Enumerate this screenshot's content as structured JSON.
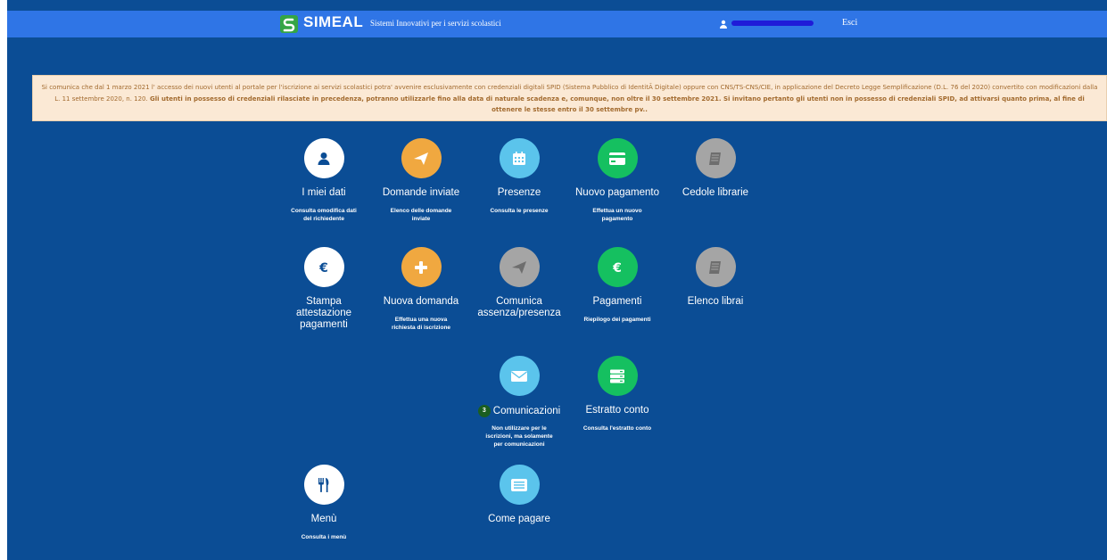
{
  "header": {
    "logo_text": "SIMEAL",
    "tagline": "Sistemi Innovativi per i servizi scolastici",
    "user_name": "",
    "logout_label": "Esci"
  },
  "notice": {
    "part1": "Si comunica che dal 1 marzo 2021 l' accesso dei nuovi utenti al portale per l'iscrizione ai servizi scolastici potra' avvenire esclusivamente con credenziali digitali SPID (Sistema Pubblico di IdentitÃ Digitale) oppure con CNS/TS-CNS/CIE, in applicazione del Decreto Legge Semplificazione (D.L. 76 del 2020) convertito con modificazioni dalla L. 11 settembre 2020, n. 120.",
    "part2": "Gli utenti in possesso di credenziali rilasciate in precedenza, potranno utilizzarle fino alla data di naturale scadenza e, comunque, non oltre il 30 settembre 2021. Si invitano pertanto gli utenti non in possesso di credenziali SPID, ad attivarsi quanto prima, al fine di ottenere le stesse entro il 30 settembre pv.."
  },
  "colors": {
    "background": "#0b4d95",
    "topbar": "#2f75e6",
    "white_circle": "#ffffff",
    "orange": "#f0a840",
    "light_blue": "#5bc4ec",
    "green": "#15c060",
    "gray": "#a5a5a5"
  },
  "tiles": {
    "miei_dati": {
      "title": "I miei dati",
      "desc": "Consulta omodifica dati del richiedente",
      "icon": "user-icon"
    },
    "domande_inviate": {
      "title": "Domande inviate",
      "desc": "Elenco delle domande inviate",
      "icon": "paper-plane-icon"
    },
    "presenze": {
      "title": "Presenze",
      "desc": "Consulta le presenze",
      "icon": "calendar-icon"
    },
    "nuovo_pagamento": {
      "title": "Nuovo pagamento",
      "desc": "Effettua un nuovo pagamento",
      "icon": "credit-card-icon"
    },
    "cedole_librarie": {
      "title": "Cedole librarie",
      "icon": "book-icon"
    },
    "stampa_attestazione": {
      "title": "Stampa attestazione pagamenti",
      "icon": "euro-icon"
    },
    "nuova_domanda": {
      "title": "Nuova domanda",
      "desc": "Effettua una nuova richiesta di iscrizione",
      "icon": "plus-icon"
    },
    "comunica_assenza": {
      "title": "Comunica assenza/presenza",
      "icon": "paper-plane-icon"
    },
    "pagamenti": {
      "title": "Pagamenti",
      "desc": "Riepilogo dei pagamenti",
      "icon": "euro-icon"
    },
    "elenco_librai": {
      "title": "Elenco librai",
      "icon": "book-icon"
    },
    "comunicazioni": {
      "title": "Comunicazioni",
      "badge": "3",
      "desc": "Non utilizzare per le iscrizioni, ma solamente per comunicazioni",
      "icon": "envelope-icon"
    },
    "estratto_conto": {
      "title": "Estratto conto",
      "desc": "Consulta l'estratto conto",
      "icon": "server-icon"
    },
    "menu": {
      "title": "Menù",
      "desc": "Consulta i menù",
      "icon": "fork-knife-icon"
    },
    "come_pagare": {
      "title": "Come pagare",
      "icon": "list-icon"
    }
  }
}
